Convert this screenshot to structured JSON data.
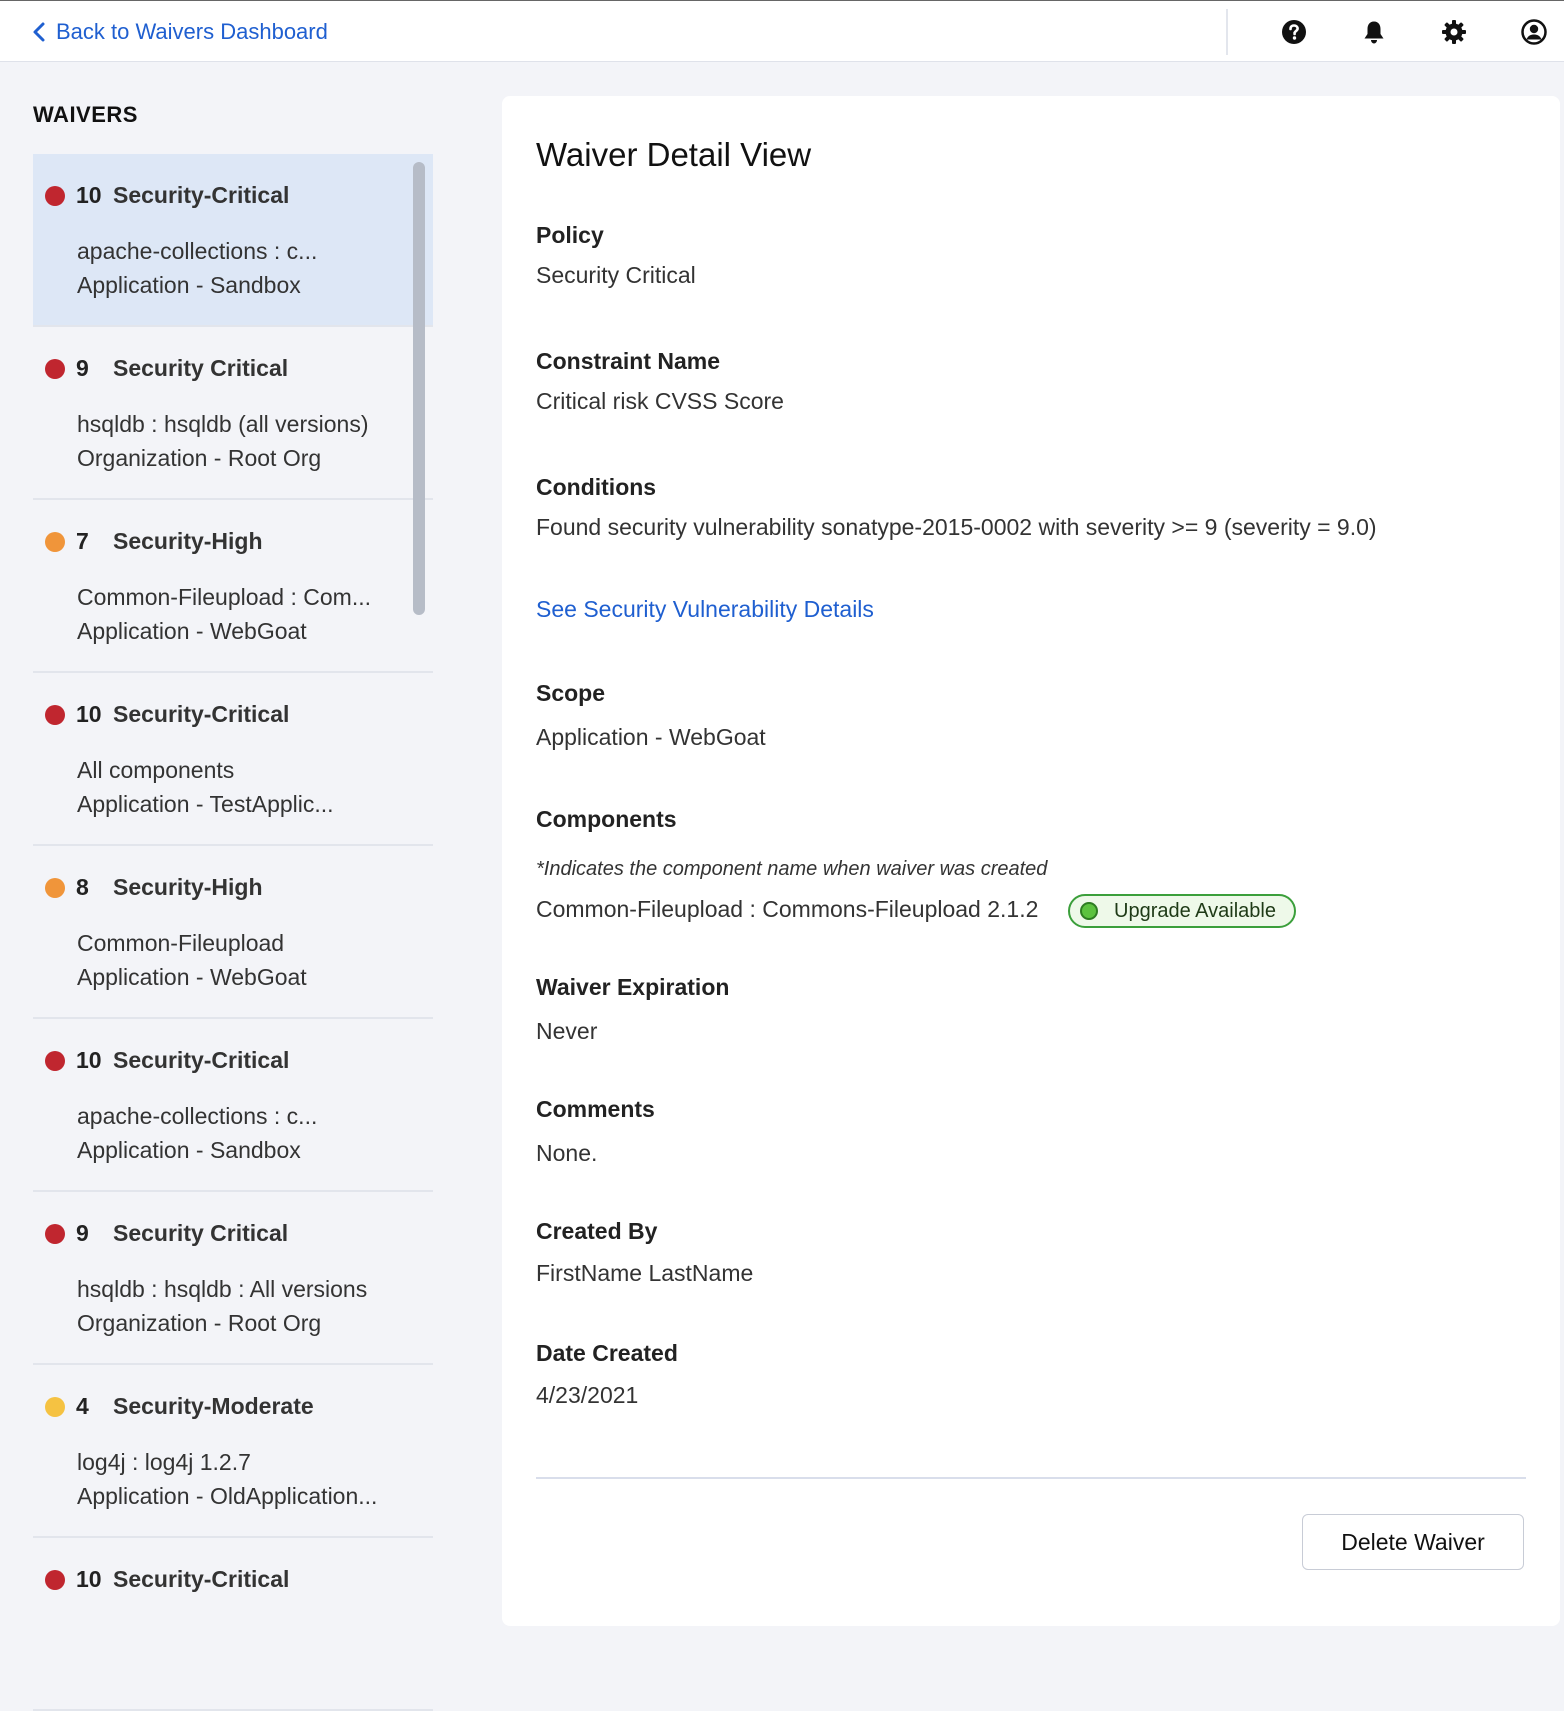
{
  "header": {
    "back_label": "Back to Waivers Dashboard",
    "icons": [
      "question-circle-icon",
      "bell-icon",
      "gear-icon",
      "user-circle-icon"
    ]
  },
  "sidebar": {
    "title": "WAIVERS",
    "items": [
      {
        "severity": "10",
        "policy": "Security-Critical",
        "component": "apache-collections : c...",
        "scope": "Application - Sandbox",
        "color": "#c0262f",
        "selected": true
      },
      {
        "severity": "9",
        "policy": "Security Critical",
        "component": "hsqldb : hsqldb (all versions)",
        "scope": "Organization - Root Org",
        "color": "#c0262f",
        "selected": false
      },
      {
        "severity": "7",
        "policy": "Security-High",
        "component": "Common-Fileupload : Com...",
        "scope": "Application - WebGoat",
        "color": "#f0953a",
        "selected": false
      },
      {
        "severity": "10",
        "policy": "Security-Critical",
        "component": "All components",
        "scope": "Application - TestApplic...",
        "color": "#c0262f",
        "selected": false
      },
      {
        "severity": "8",
        "policy": "Security-High",
        "component": "Common-Fileupload",
        "scope": "Application - WebGoat",
        "color": "#f0953a",
        "selected": false
      },
      {
        "severity": "10",
        "policy": "Security-Critical",
        "component": "apache-collections : c...",
        "scope": "Application - Sandbox",
        "color": "#c0262f",
        "selected": false
      },
      {
        "severity": "9",
        "policy": "Security Critical",
        "component": "hsqldb : hsqldb : All versions",
        "scope": "Organization - Root Org",
        "color": "#c0262f",
        "selected": false
      },
      {
        "severity": "4",
        "policy": "Security-Moderate",
        "component": "log4j : log4j 1.2.7",
        "scope": "Application - OldApplication...",
        "color": "#f5c242",
        "selected": false
      },
      {
        "severity": "10",
        "policy": "Security-Critical",
        "component": "",
        "scope": "",
        "color": "#c0262f",
        "selected": false
      }
    ]
  },
  "detail": {
    "title": "Waiver Detail View",
    "policy_label": "Policy",
    "policy_value": "Security Critical",
    "constraint_label": "Constraint Name",
    "constraint_value": "Critical risk CVSS Score",
    "conditions_label": "Conditions",
    "conditions_value": "Found security vulnerability sonatype-2015-0002 with severity >= 9 (severity = 9.0)",
    "vuln_link": "See Security Vulnerability Details",
    "scope_label": "Scope",
    "scope_value": "Application - WebGoat",
    "components_label": "Components",
    "components_note": "*Indicates the component name when waiver was created",
    "component_value": "Common-Fileupload : Commons-Fileupload 2.1.2",
    "upgrade_badge": "Upgrade Available",
    "expiration_label": "Waiver Expiration",
    "expiration_value": "Never",
    "comments_label": "Comments",
    "comments_value": "None.",
    "created_by_label": "Created By",
    "created_by_value": "FirstName LastName",
    "date_created_label": "Date Created",
    "date_created_value": "4/23/2021",
    "delete_button": "Delete Waiver"
  },
  "colors": {
    "accent": "#1f5fd0",
    "critical": "#c0262f",
    "high": "#f0953a",
    "moderate": "#f5c242",
    "selected_bg": "#dde7f6",
    "upgrade_green": "#5cc23f"
  }
}
